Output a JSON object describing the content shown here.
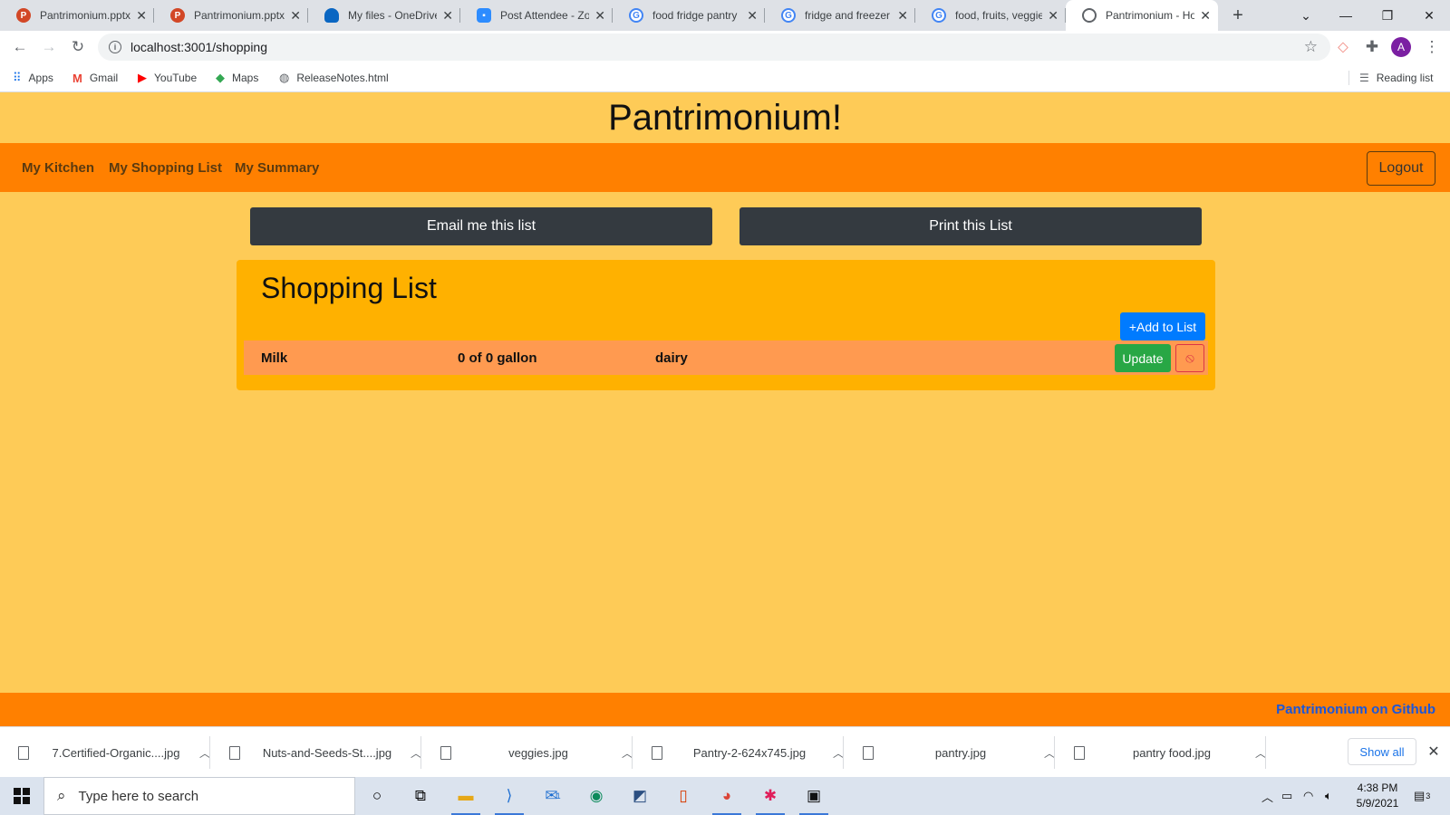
{
  "browser": {
    "tabs": [
      {
        "title": "Pantrimonium.pptx",
        "icon": "powerpoint-icon",
        "active": false
      },
      {
        "title": "Pantrimonium.pptx",
        "icon": "powerpoint-icon",
        "active": false
      },
      {
        "title": "My files - OneDrive",
        "icon": "onedrive-icon",
        "active": false
      },
      {
        "title": "Post Attendee - Zo",
        "icon": "zoom-icon",
        "active": false
      },
      {
        "title": "food fridge pantry",
        "icon": "google-icon",
        "active": false
      },
      {
        "title": "fridge and freezer s",
        "icon": "google-icon",
        "active": false
      },
      {
        "title": "food, fruits, veggie",
        "icon": "google-icon",
        "active": false
      },
      {
        "title": "Pantrimonium - Ho",
        "icon": "globe-icon",
        "active": true
      }
    ],
    "url": "localhost:3001/shopping",
    "profile_initial": "A",
    "bookmarks": [
      "Apps",
      "Gmail",
      "YouTube",
      "Maps",
      "ReleaseNotes.html"
    ],
    "reading_list": "Reading list"
  },
  "app": {
    "title": "Pantrimonium!",
    "nav": [
      "My Kitchen",
      "My Shopping List",
      "My Summary"
    ],
    "logout": "Logout",
    "email_button": "Email me this list",
    "print_button": "Print this List",
    "card_title": "Shopping List",
    "add_button": "+Add to List",
    "items": [
      {
        "name": "Milk",
        "quantity": "0 of 0 gallon",
        "category": "dairy"
      }
    ],
    "update_button": "Update",
    "footer_link": "Pantrimonium on Github"
  },
  "downloads": {
    "files": [
      "7.Certified-Organic....jpg",
      "Nuts-and-Seeds-St....jpg",
      "veggies.jpg",
      "Pantry-2-624x745.jpg",
      "pantry.jpg",
      "pantry food.jpg"
    ],
    "show_all": "Show all"
  },
  "taskbar": {
    "search_placeholder": "Type here to search",
    "mail_badge": "1",
    "time": "4:38 PM",
    "date": "5/9/2021",
    "notifications": "3"
  },
  "colors": {
    "header_bg": "#fecb57",
    "nav_bg": "#ff8000",
    "card_bg": "#ffb100",
    "row_bg": "#ff9a50",
    "add_button": "#007bff",
    "update_button": "#28a745",
    "cancel_button": "#dc3545"
  }
}
